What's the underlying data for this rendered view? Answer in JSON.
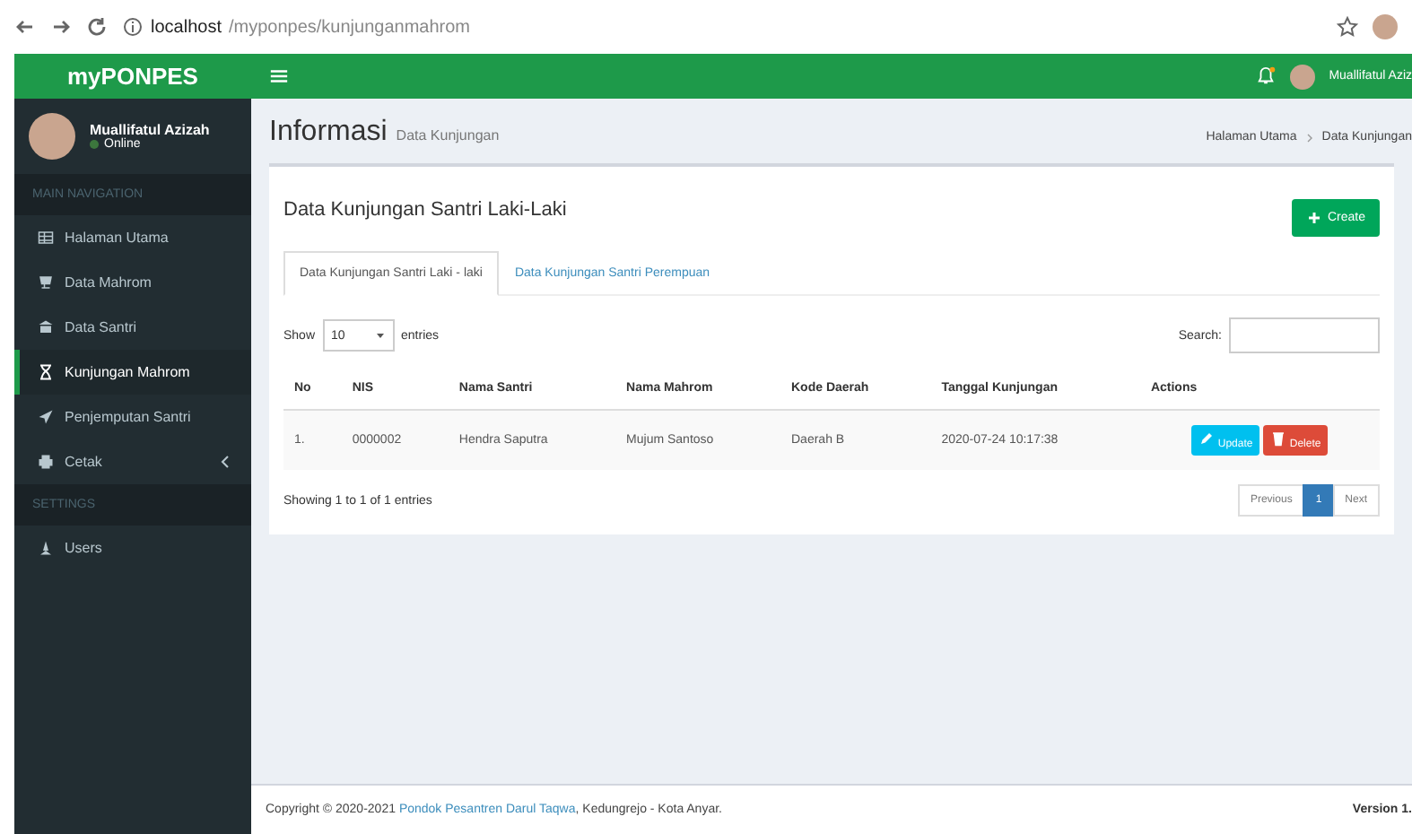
{
  "browser": {
    "url_host": "localhost",
    "url_path": "/myponpes/kunjunganmahrom"
  },
  "brand": "myPONPES",
  "user_panel": {
    "name": "Muallifatul Azizah",
    "status": "Online"
  },
  "header": {
    "user_name": "Muallifatul Aziz"
  },
  "sidebar": {
    "items": [
      {
        "kind": "header",
        "label": "MAIN NAVIGATION"
      },
      {
        "kind": "link",
        "label": "Halaman Utama",
        "selected": false
      },
      {
        "kind": "link",
        "label": "Data Mahrom",
        "selected": false
      },
      {
        "kind": "link",
        "label": "Data Santri",
        "selected": false
      },
      {
        "kind": "link",
        "label": "Kunjungan Mahrom",
        "selected": true
      },
      {
        "kind": "link",
        "label": "Penjemputan Santri",
        "selected": false
      },
      {
        "kind": "link",
        "label": "Cetak",
        "selected": false,
        "has_children": true
      },
      {
        "kind": "header",
        "label": "SETTINGS"
      },
      {
        "kind": "link",
        "label": "Users",
        "selected": false
      }
    ]
  },
  "page": {
    "title": "Informasi",
    "subtitle": "Data Kunjungan",
    "breadcrumb": [
      "Halaman Utama",
      "Data Kunjungan"
    ]
  },
  "box": {
    "title": "Data Kunjungan Santri Laki-Laki",
    "create_button": "Create"
  },
  "tabs": [
    {
      "label": "Data Kunjungan Santri Laki - laki",
      "selected": true
    },
    {
      "label": "Data Kunjungan Santri Perempuan",
      "selected": false
    }
  ],
  "table_controls": {
    "show_label": "Show",
    "page_size": "10",
    "entries_label": "entries",
    "search_label": "Search:"
  },
  "table": {
    "columns": [
      "No",
      "NIS",
      "Nama Santri",
      "Nama Mahrom",
      "Kode Daerah",
      "Tanggal Kunjungan",
      "Actions"
    ],
    "rows": [
      {
        "cells": [
          "1.",
          "0000002",
          "Hendra Saputra",
          "Mujum Santoso",
          "Daerah B",
          "2020-07-24 10:17:38"
        ],
        "actions": [
          "Update",
          "Delete"
        ]
      }
    ]
  },
  "table_footer": {
    "info": "Showing 1 to 1 of 1 entries",
    "pagination": [
      {
        "label": "Previous",
        "selected": false
      },
      {
        "label": "1",
        "selected": true
      },
      {
        "label": "Next",
        "selected": false
      }
    ]
  },
  "footer": {
    "copyright": "Copyright © 2020-2021 ",
    "link": "Pondok Pesantren Darul Taqwa",
    "rest": ", Kedungrejo - Kota Anyar.",
    "version": "Version 1."
  }
}
